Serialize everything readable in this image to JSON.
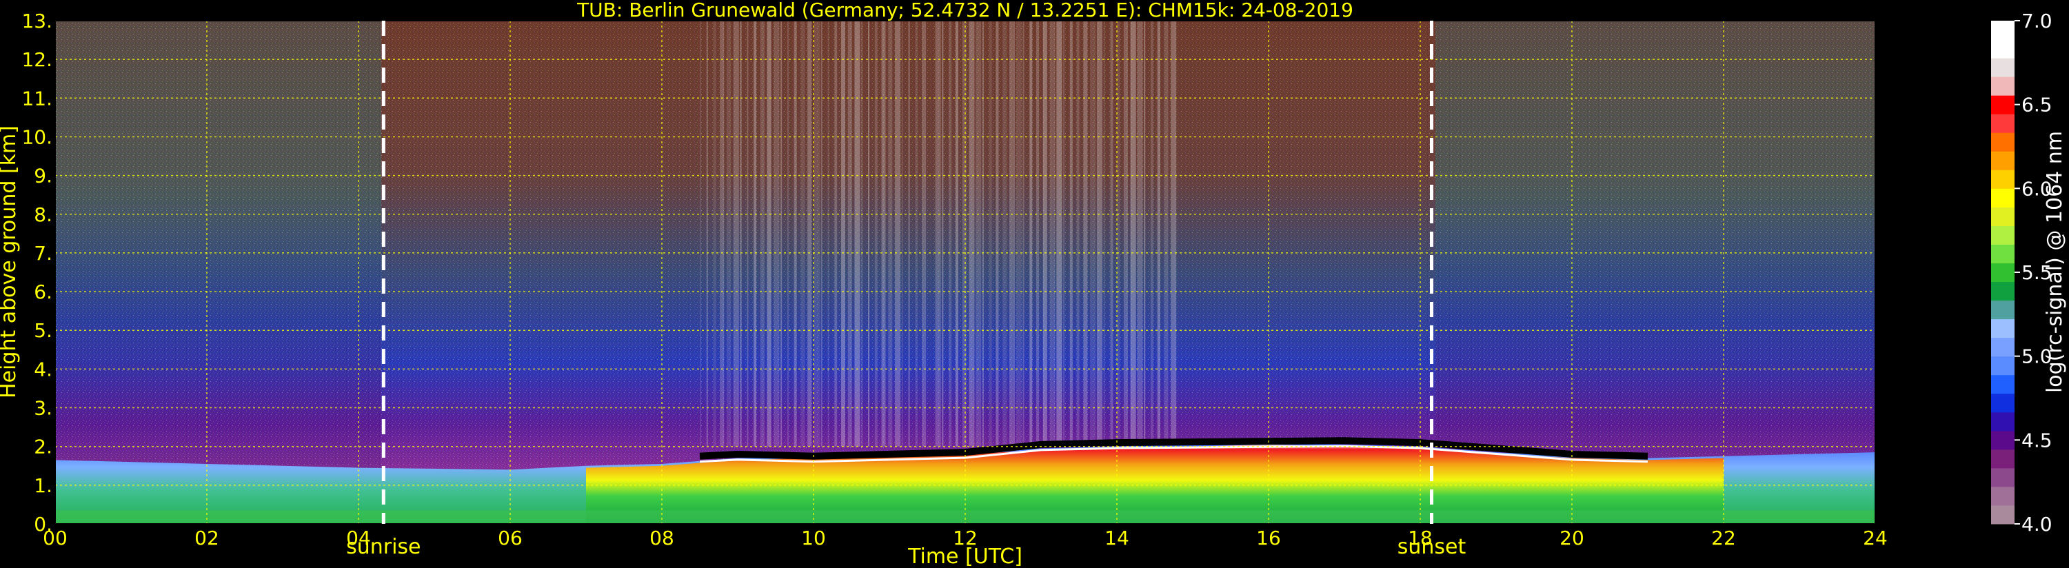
{
  "chart_data": {
    "type": "heatmap",
    "title": "TUB: Berlin Grunewald (Germany; 52.4732 N / 13.2251 E):    CHM15k: 24-08-2019",
    "xlabel": "Time [UTC]",
    "ylabel": "Height above ground [km]",
    "xlim": [
      0,
      24
    ],
    "ylim": [
      0,
      13
    ],
    "x_ticks": [
      "00",
      "02",
      "04",
      "06",
      "08",
      "10",
      "12",
      "14",
      "16",
      "18",
      "20",
      "22",
      "24"
    ],
    "y_ticks": [
      "0.",
      "1.",
      "2.",
      "3.",
      "4.",
      "5.",
      "6.",
      "7.",
      "8.",
      "9.",
      "10.",
      "11.",
      "12.",
      "13."
    ],
    "grid": true,
    "colorbar": {
      "label": "log(rc-signal) @ 1064 nm",
      "range": [
        4.0,
        7.0
      ],
      "ticks": [
        "4.0",
        "4.5",
        "5.0",
        "5.5",
        "6.0",
        "6.5",
        "7.0"
      ],
      "colors": [
        "#a88a9c",
        "#a07098",
        "#8c4a8c",
        "#7a1f7a",
        "#5a0a8a",
        "#3010b0",
        "#1030e0",
        "#2060ff",
        "#5a8cff",
        "#7aa0ff",
        "#9cc0ff",
        "#50a0a0",
        "#10a040",
        "#30c030",
        "#70e040",
        "#b0f040",
        "#e0f020",
        "#ffff00",
        "#ffd000",
        "#ffa000",
        "#ff7000",
        "#ff3a3a",
        "#ff0000",
        "#f0b8b8",
        "#e8e0e0",
        "#ffffff",
        "#ffffff"
      ]
    },
    "annotations": [
      {
        "label": "sunrise",
        "x": 4.33
      },
      {
        "label": "sunset",
        "x": 18.15
      }
    ],
    "aerosol_layer_top_km": [
      [
        0,
        1.65
      ],
      [
        2,
        1.55
      ],
      [
        4,
        1.45
      ],
      [
        6,
        1.4
      ],
      [
        7,
        1.5
      ],
      [
        8,
        1.55
      ],
      [
        9,
        1.7
      ],
      [
        10,
        1.75
      ],
      [
        11,
        1.8
      ],
      [
        12,
        1.85
      ],
      [
        13,
        1.95
      ],
      [
        14,
        2.0
      ],
      [
        15,
        2.05
      ],
      [
        16,
        2.1
      ],
      [
        17,
        2.05
      ],
      [
        18,
        2.0
      ],
      [
        19,
        1.85
      ],
      [
        20,
        1.75
      ],
      [
        21,
        1.7
      ],
      [
        22,
        1.75
      ],
      [
        23,
        1.8
      ],
      [
        24,
        1.85
      ]
    ],
    "cloud_base_km": [
      [
        8.5,
        1.75
      ],
      [
        9,
        1.8
      ],
      [
        10,
        1.75
      ],
      [
        11,
        1.8
      ],
      [
        12,
        1.85
      ],
      [
        13,
        2.05
      ],
      [
        14,
        2.1
      ],
      [
        17,
        2.15
      ],
      [
        18,
        2.1
      ],
      [
        20,
        1.8
      ],
      [
        21,
        1.75
      ]
    ],
    "colors": {
      "axis_text": "#ffff00",
      "grid": "#ffff00",
      "colorbar_text": "#ffffff",
      "background": "#000000"
    }
  }
}
